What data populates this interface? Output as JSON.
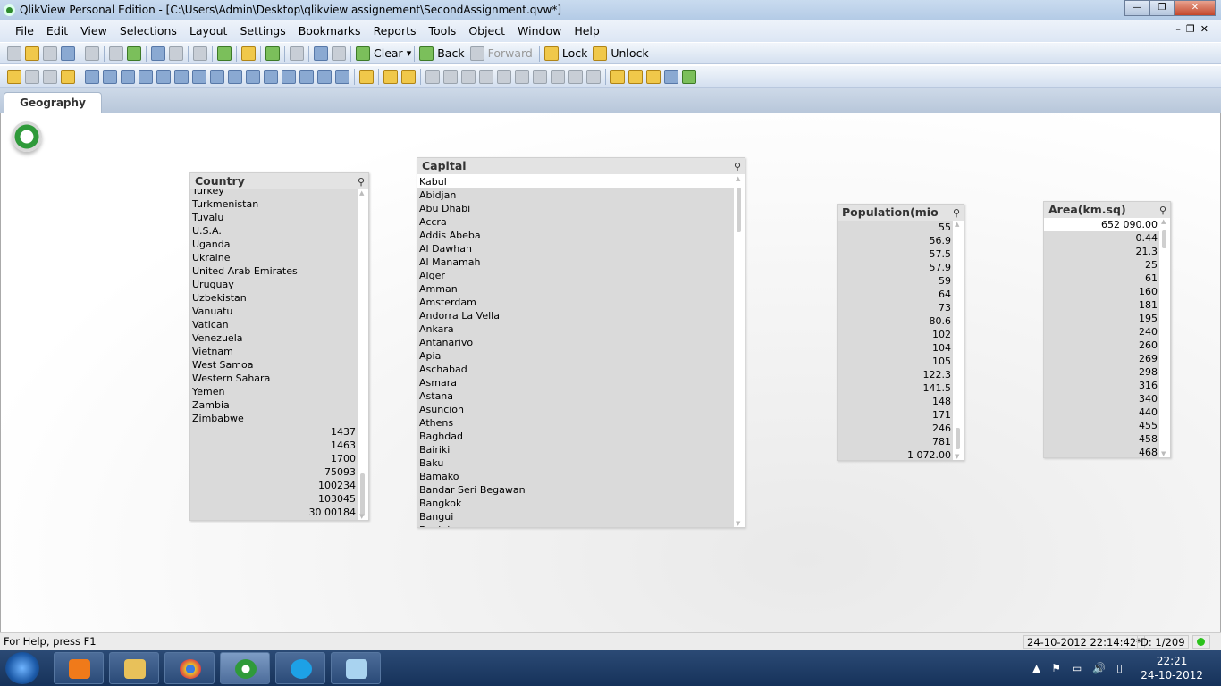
{
  "window": {
    "title": "QlikView Personal Edition - [C:\\Users\\Admin\\Desktop\\qlikview assignement\\SecondAssignment.qvw*]"
  },
  "menu": [
    "File",
    "Edit",
    "View",
    "Selections",
    "Layout",
    "Settings",
    "Bookmarks",
    "Reports",
    "Tools",
    "Object",
    "Window",
    "Help"
  ],
  "toolbar": {
    "clear": "Clear",
    "back": "Back",
    "forward": "Forward",
    "lock": "Lock",
    "unlock": "Unlock"
  },
  "tabs": [
    {
      "label": "Geography",
      "active": true
    }
  ],
  "listboxes": {
    "country": {
      "title": "Country",
      "items": [
        "Turkey",
        "Turkmenistan",
        "Tuvalu",
        "U.S.A.",
        "Uganda",
        "Ukraine",
        "United Arab Emirates",
        "Uruguay",
        "Uzbekistan",
        "Vanuatu",
        "Vatican",
        "Venezuela",
        "Vietnam",
        "West Samoa",
        "Western Sahara",
        "Yemen",
        "Zambia",
        "Zimbabwe"
      ],
      "numeric_items": [
        "1437",
        "1463",
        "1700",
        "75093",
        "100234",
        "103045",
        "30 00184"
      ]
    },
    "capital": {
      "title": "Capital",
      "selected": "Kabul",
      "items": [
        "Abidjan",
        "Abu Dhabi",
        "Accra",
        "Addis Abeba",
        "Al Dawhah",
        "Al Manamah",
        "Alger",
        "Amman",
        "Amsterdam",
        "Andorra La Vella",
        "Ankara",
        "Antanarivo",
        "Apia",
        "Aschabad",
        "Asmara",
        "Astana",
        "Asuncion",
        "Athens",
        "Baghdad",
        "Bairiki",
        "Baku",
        "Bamako",
        "Bandar Seri Begawan",
        "Bangkok",
        "Bangui",
        "Banjul"
      ]
    },
    "population": {
      "title": "Population(mio",
      "items": [
        "55",
        "56.9",
        "57.5",
        "57.9",
        "59",
        "64",
        "73",
        "80.6",
        "102",
        "104",
        "105",
        "122.3",
        "141.5",
        "148",
        "171",
        "246",
        "781",
        "1 072.00"
      ]
    },
    "area": {
      "title": "Area(km.sq)",
      "selected": "652 090.00",
      "items": [
        "0.44",
        "21.3",
        "25",
        "61",
        "160",
        "181",
        "195",
        "240",
        "260",
        "269",
        "298",
        "316",
        "340",
        "440",
        "455",
        "458",
        "468"
      ]
    }
  },
  "status": {
    "help": "For Help, press F1",
    "timestamp": "24-10-2012 22:14:42*",
    "doc": "D: 1/209"
  },
  "taskbar": {
    "time": "22:21",
    "date": "24-10-2012"
  }
}
